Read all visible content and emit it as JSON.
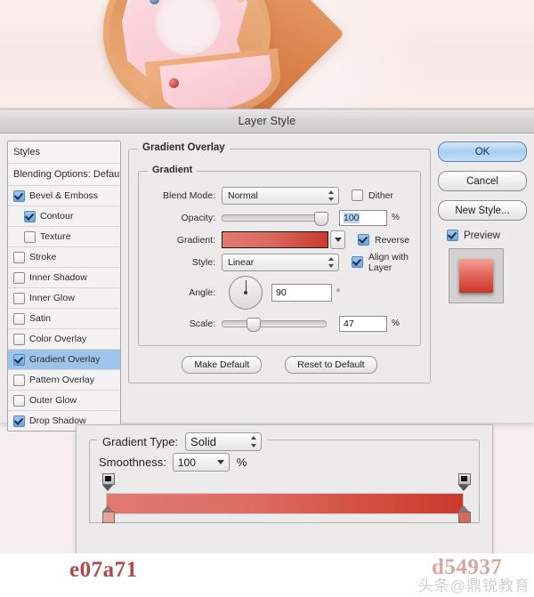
{
  "window": {
    "title": "Layer Style"
  },
  "styles_panel": {
    "header": "Styles",
    "blending_options": "Blending Options: Default",
    "items": [
      {
        "label": "Bevel & Emboss",
        "checked": true,
        "indent": false,
        "selected": false
      },
      {
        "label": "Contour",
        "checked": true,
        "indent": true,
        "selected": false
      },
      {
        "label": "Texture",
        "checked": false,
        "indent": true,
        "selected": false
      },
      {
        "label": "Stroke",
        "checked": false,
        "indent": false,
        "selected": false
      },
      {
        "label": "Inner Shadow",
        "checked": false,
        "indent": false,
        "selected": false
      },
      {
        "label": "Inner Glow",
        "checked": false,
        "indent": false,
        "selected": false
      },
      {
        "label": "Satin",
        "checked": false,
        "indent": false,
        "selected": false
      },
      {
        "label": "Color Overlay",
        "checked": false,
        "indent": false,
        "selected": false
      },
      {
        "label": "Gradient Overlay",
        "checked": true,
        "indent": false,
        "selected": true
      },
      {
        "label": "Pattern Overlay",
        "checked": false,
        "indent": false,
        "selected": false
      },
      {
        "label": "Outer Glow",
        "checked": false,
        "indent": false,
        "selected": false
      },
      {
        "label": "Drop Shadow",
        "checked": true,
        "indent": false,
        "selected": false
      }
    ]
  },
  "gradient_overlay": {
    "title": "Gradient Overlay",
    "group_title": "Gradient",
    "blend_mode": {
      "label": "Blend Mode:",
      "value": "Normal"
    },
    "opacity": {
      "label": "Opacity:",
      "value": "100",
      "unit": "%"
    },
    "gradient": {
      "label": "Gradient:",
      "start_color": "#e07a71",
      "end_color": "#c9392c"
    },
    "style": {
      "label": "Style:",
      "value": "Linear"
    },
    "angle": {
      "label": "Angle:",
      "value": "90",
      "unit": "°"
    },
    "scale": {
      "label": "Scale:",
      "value": "47",
      "unit": "%"
    },
    "dither": {
      "label": "Dither",
      "checked": false
    },
    "reverse": {
      "label": "Reverse",
      "checked": true
    },
    "align_with_layer": {
      "label": "Align with Layer",
      "checked": true
    },
    "make_default": "Make Default",
    "reset_to_default": "Reset to Default"
  },
  "buttons": {
    "ok": "OK",
    "cancel": "Cancel",
    "new_style": "New Style...",
    "preview": {
      "label": "Preview",
      "checked": true
    }
  },
  "gradient_editor": {
    "gradient_type": {
      "label": "Gradient Type:",
      "value": "Solid"
    },
    "smoothness": {
      "label": "Smoothness:",
      "value": "100",
      "unit": "%"
    },
    "ramp": {
      "start_color": "#e07a71",
      "end_color": "#c9392c",
      "left_stop_position": "0%",
      "right_stop_position": "100%"
    }
  },
  "footer": {
    "hex_left": "e07a71",
    "hex_right": "d54937",
    "watermark": "头条@鼎锐教育"
  }
}
